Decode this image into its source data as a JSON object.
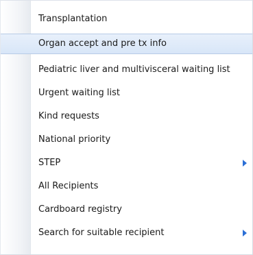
{
  "menu": {
    "items": [
      {
        "label": "Transplantation"
      },
      {
        "label": "Organ accept and pre tx info",
        "highlighted": true
      },
      {
        "label": "Pediatric liver and multivisceral waiting list"
      },
      {
        "label": "Urgent waiting list"
      },
      {
        "label": "Kind requests"
      },
      {
        "label": "National priority"
      },
      {
        "label": "STEP",
        "has_submenu": true
      },
      {
        "label": "All Recipients"
      },
      {
        "label": "Cardboard registry"
      },
      {
        "label": "Search for suitable recipient",
        "has_submenu": true
      }
    ]
  },
  "colors": {
    "highlight_bg": "#dce8f8",
    "highlight_border": "#b7cbe6",
    "submenu_arrow": "#2b6fd6",
    "gutter": "#eef1f5"
  },
  "icons": {
    "submenu": "chevron-right-icon"
  }
}
